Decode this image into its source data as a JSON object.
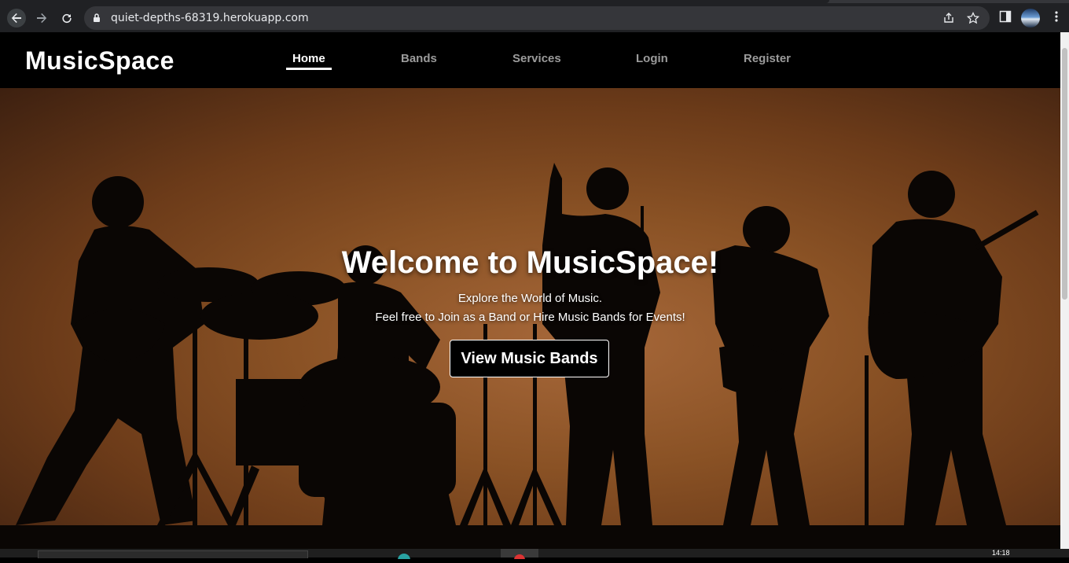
{
  "browser": {
    "url": "quiet-depths-68319.herokuapp.com"
  },
  "site": {
    "brand": "MusicSpace",
    "nav": [
      {
        "label": "Home",
        "active": true
      },
      {
        "label": "Bands",
        "active": false
      },
      {
        "label": "Services",
        "active": false
      },
      {
        "label": "Login",
        "active": false
      },
      {
        "label": "Register",
        "active": false
      }
    ]
  },
  "hero": {
    "title": "Welcome to MusicSpace!",
    "subtitle_line1": "Explore the World of Music.",
    "subtitle_line2": "Feel free to Join as a Band or Hire Music Bands for Events!",
    "cta_label": "View Music Bands"
  },
  "taskbar": {
    "clock": "14:18"
  },
  "colors": {
    "navbar_bg": "#000000",
    "hero_bg": "#8a5225",
    "nav_active": "#ffffff",
    "nav_inactive": "#9b9b9b"
  }
}
